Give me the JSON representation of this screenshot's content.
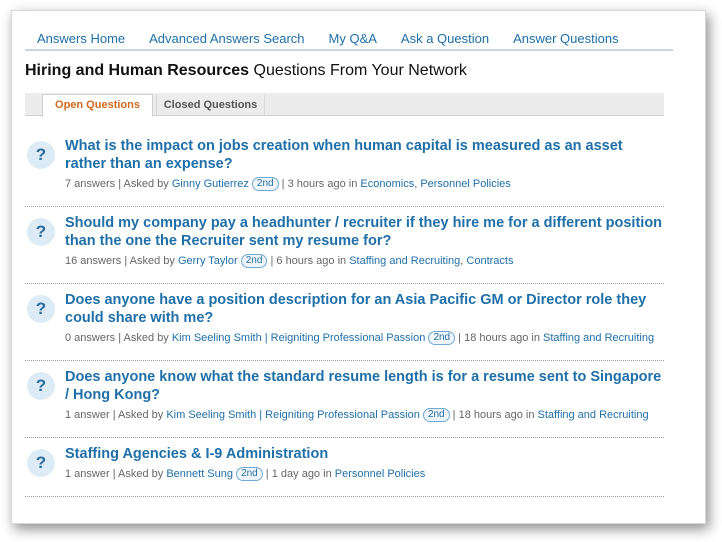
{
  "nav": {
    "items": [
      {
        "label": "Answers Home"
      },
      {
        "label": "Advanced Answers Search"
      },
      {
        "label": "My Q&A"
      },
      {
        "label": "Ask a Question"
      },
      {
        "label": "Answer Questions"
      }
    ]
  },
  "heading": {
    "bold": "Hiring and Human Resources",
    "rest": " Questions From Your Network"
  },
  "tabs": {
    "open": "Open Questions",
    "closed": "Closed Questions"
  },
  "question_icon": "question-mark-icon",
  "questions": [
    {
      "title": "What is the impact on jobs creation when human capital is measured as an asset rather than an expense?",
      "answers": "7 answers",
      "asked_by_label": "Asked by",
      "author": "Ginny Gutierrez",
      "degree": "2nd",
      "time": "3 hours ago",
      "in_label": "in",
      "categories": [
        "Economics",
        "Personnel Policies"
      ]
    },
    {
      "title": "Should my company pay a headhunter / recruiter if they hire me for a different position than the one the Recruiter sent my resume for?",
      "answers": "16 answers",
      "asked_by_label": "Asked by",
      "author": "Gerry Taylor",
      "degree": "2nd",
      "time": "6 hours ago",
      "in_label": "in",
      "categories": [
        "Staffing and Recruiting",
        "Contracts"
      ]
    },
    {
      "title": "Does anyone have a position description for an Asia Pacific GM or Director role they could share with me?",
      "answers": "0 answers",
      "asked_by_label": "Asked by",
      "author": "Kim Seeling Smith | Reigniting Professional Passion",
      "degree": "2nd",
      "time": "18 hours ago",
      "in_label": "in",
      "categories": [
        "Staffing and Recruiting"
      ]
    },
    {
      "title": "Does anyone know what the standard resume length is for a resume sent to Singapore / Hong Kong?",
      "answers": "1 answer",
      "asked_by_label": "Asked by",
      "author": "Kim Seeling Smith | Reigniting Professional Passion",
      "degree": "2nd",
      "time": "18 hours ago",
      "in_label": "in",
      "categories": [
        "Staffing and Recruiting"
      ]
    },
    {
      "title": "Staffing Agencies & I-9 Administration",
      "answers": "1 answer",
      "asked_by_label": "Asked by",
      "author": "Bennett Sung",
      "degree": "2nd",
      "time": "1 day ago",
      "in_label": "in",
      "categories": [
        "Personnel Policies"
      ]
    }
  ],
  "colors": {
    "link": "#1f6fa8",
    "active_tab": "#d2691e",
    "icon_bg": "#dcebf5"
  }
}
